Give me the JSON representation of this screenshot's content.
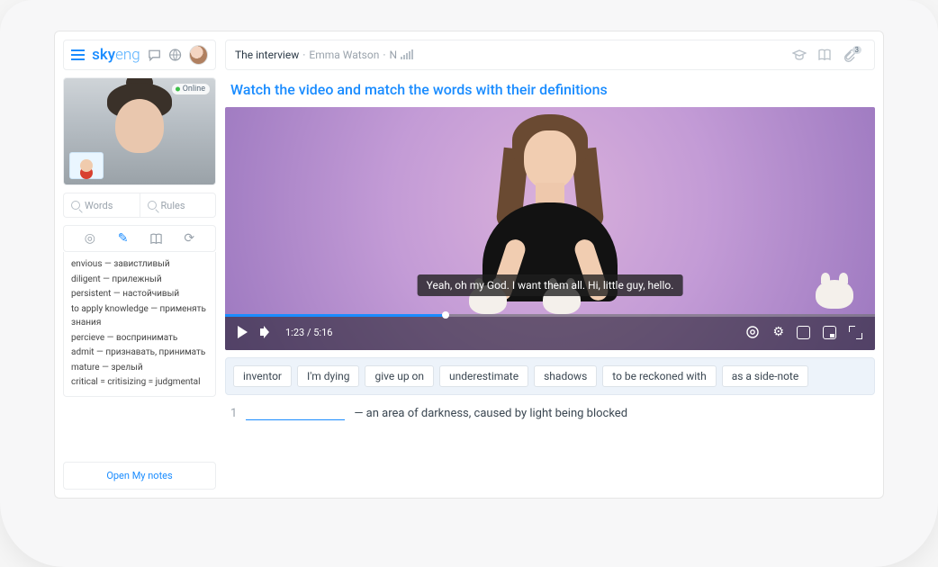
{
  "brand": {
    "name_strong": "sky",
    "name_thin": "eng"
  },
  "sidebar": {
    "online_label": "Online",
    "tabs": {
      "words": "Words",
      "rules": "Rules"
    },
    "vocab": [
      "envious — завистливый",
      "diligent — прилежный",
      "persistent — настойчивый",
      "to apply knowledge — применять знания",
      "percieve — воспринимать",
      "admit — признавать, принимать",
      "mature — зрелый",
      "critical = critisizing = judgmental"
    ],
    "open_notes": "Open My notes"
  },
  "header": {
    "lesson": "The interview",
    "sub": "Emma Watson",
    "level": "N",
    "attachments_count": "3"
  },
  "task": {
    "title": "Watch the video and match the words with their definitions"
  },
  "video": {
    "caption": "Yeah, oh my God. I want them all. Hi, little guy, hello.",
    "elapsed": "1:23",
    "total": "5:16"
  },
  "chips": [
    "inventor",
    "I'm dying",
    "give up on",
    "underestimate",
    "shadows",
    "to be reckoned with",
    "as a side-note"
  ],
  "matches": [
    {
      "n": "1",
      "def": "— an area of darkness, caused by light being blocked"
    }
  ]
}
